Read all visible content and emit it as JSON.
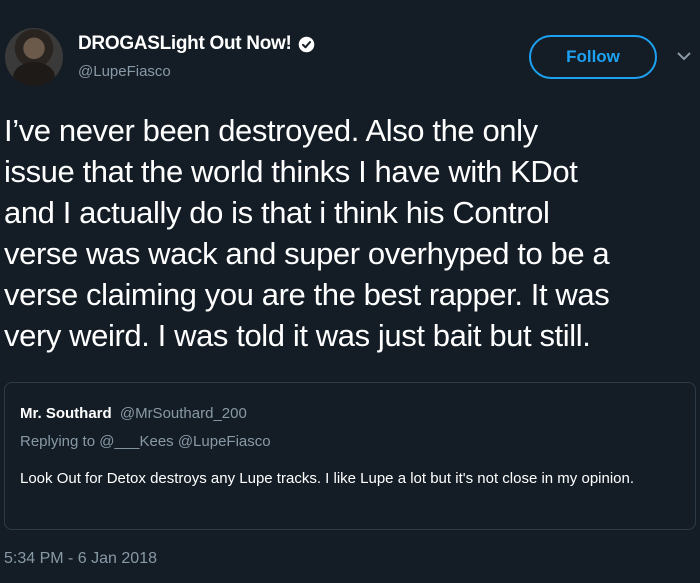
{
  "author": {
    "display_name": "DROGASLight Out Now!",
    "handle": "@LupeFiasco",
    "verified_icon": "verified-badge-icon"
  },
  "follow_button": {
    "label": "Follow",
    "color": "#1da1f2"
  },
  "tweet": {
    "lines": [
      "I’ve never been destroyed. Also the only",
      "issue that the world thinks I have with KDot",
      "and I actually do is that i think his Control",
      "verse was wack and super overhyped to be a",
      "verse claiming you are the best rapper. It was",
      "very weird. I was told it was just bait but still."
    ],
    "timestamp": "5:34 PM - 6 Jan 2018"
  },
  "quoted_tweet": {
    "name": "Mr. Southard",
    "handle": "@MrSouthard_200",
    "replying_to": "Replying to @___Kees @LupeFiasco",
    "text": "Look Out for Detox destroys any Lupe tracks. I like Lupe a lot but it's not close in my opinion."
  },
  "colors": {
    "background": "#141d26",
    "secondary_text": "#8899a6",
    "accent": "#1da1f2"
  }
}
